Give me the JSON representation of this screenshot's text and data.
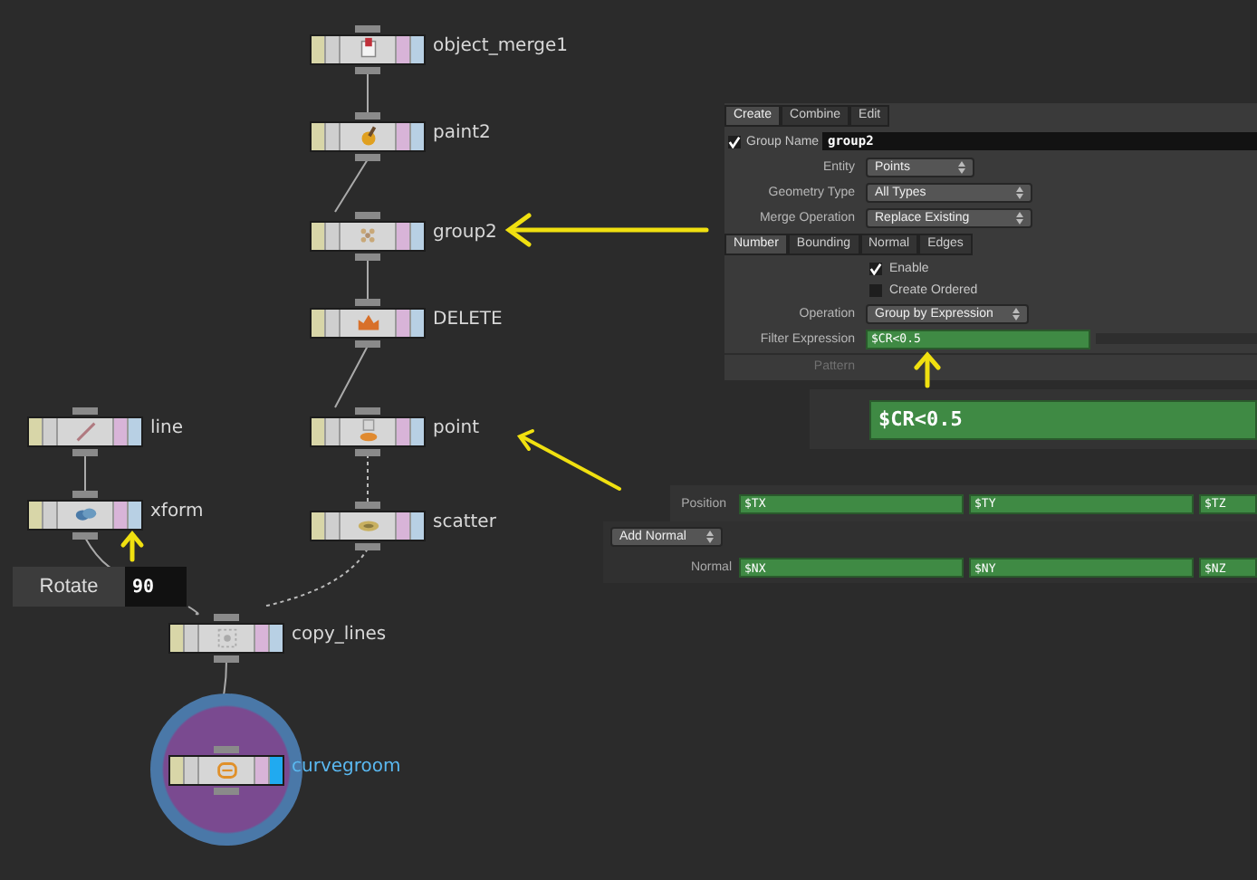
{
  "network": {
    "nodes": [
      {
        "name": "object_merge1",
        "kind": "merge",
        "display": false
      },
      {
        "name": "paint2",
        "kind": "paint",
        "display": false
      },
      {
        "name": "group2",
        "kind": "group",
        "display": false
      },
      {
        "name": "DELETE",
        "kind": "delete",
        "display": false
      },
      {
        "name": "point",
        "kind": "point",
        "display": false
      },
      {
        "name": "scatter",
        "kind": "scatter",
        "display": false
      },
      {
        "name": "line",
        "kind": "line",
        "display": false
      },
      {
        "name": "xform",
        "kind": "xform",
        "display": false
      },
      {
        "name": "copy_lines",
        "kind": "copy",
        "display": false
      },
      {
        "name": "curvegroom",
        "kind": "groom",
        "display": true
      }
    ]
  },
  "rotate_overlay": {
    "label": "Rotate",
    "value": "90"
  },
  "group_panel": {
    "tabs": [
      {
        "label": "Create",
        "selected": true
      },
      {
        "label": "Combine",
        "selected": false
      },
      {
        "label": "Edit",
        "selected": false
      }
    ],
    "group_name": {
      "label": "Group Name",
      "checked": true,
      "value": "group2"
    },
    "menus": [
      {
        "label": "Entity",
        "value": "Points"
      },
      {
        "label": "Geometry Type",
        "value": "All Types"
      },
      {
        "label": "Merge Operation",
        "value": "Replace Existing"
      }
    ],
    "subtabs": [
      {
        "label": "Number",
        "selected": true
      },
      {
        "label": "Bounding",
        "selected": false
      },
      {
        "label": "Normal",
        "selected": false
      },
      {
        "label": "Edges",
        "selected": false
      }
    ],
    "toggles": [
      {
        "label": "Enable",
        "checked": true
      },
      {
        "label": "Create Ordered",
        "checked": false
      }
    ],
    "operation": {
      "label": "Operation",
      "value": "Group by Expression"
    },
    "filter_expression": {
      "label": "Filter Expression",
      "value": "$CR<0.5"
    },
    "pattern": {
      "label": "Pattern",
      "disabled": true
    }
  },
  "zoomed_expression": {
    "value": "$CR<0.5"
  },
  "point_panel": {
    "position": {
      "label": "Position",
      "values": [
        "$TX",
        "$TY",
        "$TZ"
      ]
    },
    "add_normal": {
      "value": "Add Normal"
    },
    "normal": {
      "label": "Normal",
      "values": [
        "$NX",
        "$NY",
        "$NZ"
      ]
    }
  }
}
